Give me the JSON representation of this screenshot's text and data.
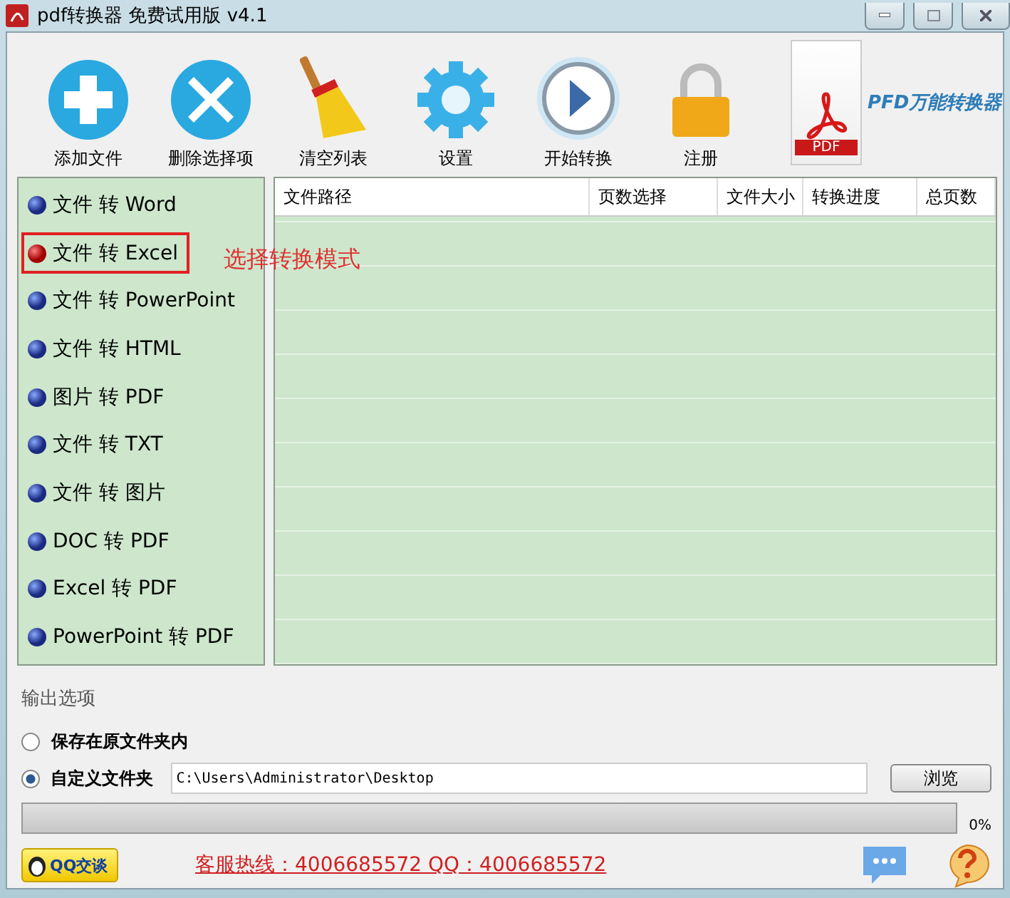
{
  "window": {
    "title": "pdf转换器 免费试用版 v4.1"
  },
  "toolbar": [
    {
      "label": "添加文件",
      "kind": "add"
    },
    {
      "label": "删除选择项",
      "kind": "delete"
    },
    {
      "label": "清空列表",
      "kind": "broom"
    },
    {
      "label": "设置",
      "kind": "gear"
    },
    {
      "label": "开始转换",
      "kind": "play"
    },
    {
      "label": "注册",
      "kind": "lock"
    }
  ],
  "logo": {
    "badge": "PDF",
    "title": "PFD万能转换器"
  },
  "modes": [
    {
      "label": "文件 转 Word",
      "selected": false
    },
    {
      "label": "文件 转 Excel",
      "selected": true
    },
    {
      "label": "文件 转 PowerPoint",
      "selected": false
    },
    {
      "label": "文件 转 HTML",
      "selected": false
    },
    {
      "label": "图片 转 PDF",
      "selected": false
    },
    {
      "label": "文件 转 TXT",
      "selected": false
    },
    {
      "label": "文件 转 图片",
      "selected": false
    },
    {
      "label": "DOC 转 PDF",
      "selected": false
    },
    {
      "label": "Excel 转 PDF",
      "selected": false
    },
    {
      "label": "PowerPoint 转 PDF",
      "selected": false
    }
  ],
  "annotation": "选择转换模式",
  "table": {
    "columns": [
      "文件路径",
      "页数选择",
      "文件大小",
      "转换进度",
      "总页数"
    ]
  },
  "output": {
    "heading": "输出选项",
    "options": [
      {
        "label": "保存在原文件夹内",
        "selected": false
      },
      {
        "label": "自定义文件夹",
        "selected": true
      }
    ],
    "path": "C:\\Users\\Administrator\\Desktop",
    "browse": "浏览"
  },
  "progress": {
    "level": 0,
    "reading": "0%"
  },
  "footer": {
    "qq_button": "QQ交谈",
    "hotline": "客服热线：4006685572 QQ：4006685572"
  }
}
